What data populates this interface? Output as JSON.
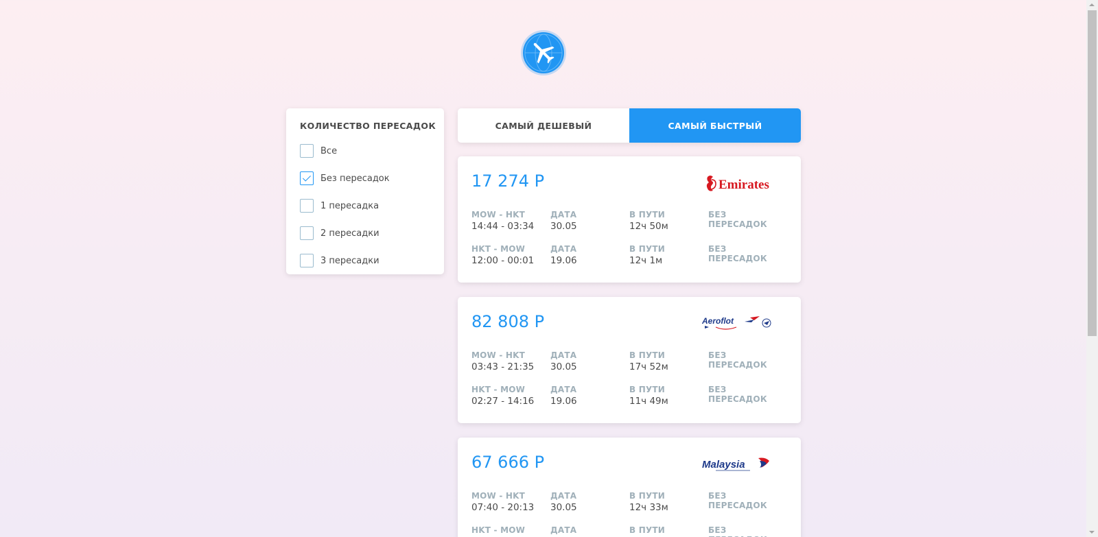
{
  "filter": {
    "title": "КОЛИЧЕСТВО ПЕРЕСАДОК",
    "options": [
      {
        "label": "Все",
        "checked": false
      },
      {
        "label": "Без пересадок",
        "checked": true
      },
      {
        "label": "1 пересадка",
        "checked": false
      },
      {
        "label": "2 пересадки",
        "checked": false
      },
      {
        "label": "3 пересадки",
        "checked": false
      }
    ]
  },
  "tabs": [
    {
      "label": "САМЫЙ ДЕШЕВЫЙ",
      "active": false
    },
    {
      "label": "САМЫЙ БЫСТРЫЙ",
      "active": true
    }
  ],
  "colors": {
    "accent": "#2196f3",
    "muted": "#a0b0b9",
    "text": "#4a4a4a"
  },
  "tickets": [
    {
      "price": "17 274 Р",
      "carrier": "Emirates",
      "segments": [
        {
          "route": "MOW - HKT",
          "time": "14:44 - 03:34",
          "date_label": "ДАТА",
          "date": "30.05",
          "duration_label": "В ПУТИ",
          "duration": "12ч 50м",
          "stops_label": "БЕЗ ПЕРЕСАДОК",
          "stops": ""
        },
        {
          "route": "HKT - MOW",
          "time": "12:00 - 00:01",
          "date_label": "ДАТА",
          "date": "19.06",
          "duration_label": "В ПУТИ",
          "duration": "12ч 1м",
          "stops_label": "БЕЗ ПЕРЕСАДОК",
          "stops": ""
        }
      ]
    },
    {
      "price": "82 808 Р",
      "carrier": "Aeroflot",
      "segments": [
        {
          "route": "MOW - HKT",
          "time": "03:43 - 21:35",
          "date_label": "ДАТА",
          "date": "30.05",
          "duration_label": "В ПУТИ",
          "duration": "17ч 52м",
          "stops_label": "БЕЗ ПЕРЕСАДОК",
          "stops": ""
        },
        {
          "route": "HKT - MOW",
          "time": "02:27 - 14:16",
          "date_label": "ДАТА",
          "date": "19.06",
          "duration_label": "В ПУТИ",
          "duration": "11ч 49м",
          "stops_label": "БЕЗ ПЕРЕСАДОК",
          "stops": ""
        }
      ]
    },
    {
      "price": "67 666 Р",
      "carrier": "Malaysia",
      "segments": [
        {
          "route": "MOW - HKT",
          "time": "07:40 - 20:13",
          "date_label": "ДАТА",
          "date": "30.05",
          "duration_label": "В ПУТИ",
          "duration": "12ч 33м",
          "stops_label": "БЕЗ ПЕРЕСАДОК",
          "stops": ""
        },
        {
          "route": "HKT - MOW",
          "time": "",
          "date_label": "ДАТА",
          "date": "",
          "duration_label": "В ПУТИ",
          "duration": "",
          "stops_label": "БЕЗ ПЕРЕСАДОК",
          "stops": ""
        }
      ]
    }
  ],
  "icons": {
    "logo": "airplane-globe-icon"
  }
}
